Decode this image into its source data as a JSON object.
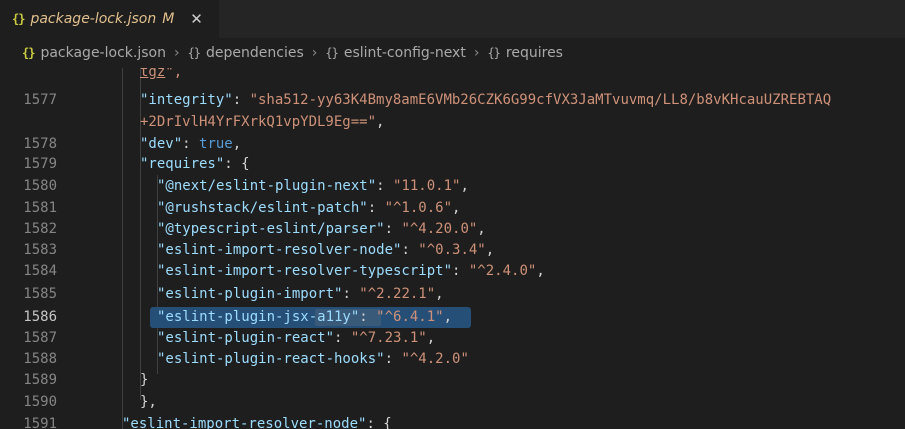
{
  "tab": {
    "icon_text": "{}",
    "title": "package-lock.json",
    "modified": "M",
    "close": "✕"
  },
  "breadcrumb": {
    "file_icon_text": "{}",
    "file": "package-lock.json",
    "obj_icon_text": "{}",
    "items": [
      "dependencies",
      "eslint-config-next",
      "requires"
    ],
    "sep": "›"
  },
  "editor": {
    "lines": [
      {
        "num": "",
        "tokens": [
          {
            "t": "tgz",
            "c": "s u"
          },
          {
            "t": "\",",
            "c": "s"
          }
        ]
      },
      {
        "num": "1577",
        "tokens": [
          {
            "t": "\"integrity\"",
            "c": "k"
          },
          {
            "t": ": ",
            "c": "p"
          },
          {
            "t": "\"sha512-yy63K4Bmy8amE6VMb26CZK6G99cfVX3JaMTvuvmq/LL8/b8vKHcauUZREBTAQ",
            "c": "s"
          }
        ]
      },
      {
        "num": "",
        "tokens": [
          {
            "t": "+2DrIvlH4YrFXrkQ1vpYDL9Eg==\"",
            "c": "s"
          },
          {
            "t": ",",
            "c": "p"
          }
        ]
      },
      {
        "num": "1578",
        "tokens": [
          {
            "t": "\"dev\"",
            "c": "k"
          },
          {
            "t": ": ",
            "c": "p"
          },
          {
            "t": "true",
            "c": "b"
          },
          {
            "t": ",",
            "c": "p"
          }
        ]
      },
      {
        "num": "1579",
        "tokens": [
          {
            "t": "\"requires\"",
            "c": "k"
          },
          {
            "t": ": {",
            "c": "p"
          }
        ]
      },
      {
        "num": "1580",
        "tokens": [
          {
            "t": "\"@next/eslint-plugin-next\"",
            "c": "k"
          },
          {
            "t": ": ",
            "c": "p"
          },
          {
            "t": "\"11.0.1\"",
            "c": "s"
          },
          {
            "t": ",",
            "c": "p"
          }
        ]
      },
      {
        "num": "1581",
        "tokens": [
          {
            "t": "\"@rushstack/eslint-patch\"",
            "c": "k"
          },
          {
            "t": ": ",
            "c": "p"
          },
          {
            "t": "\"^1.0.6\"",
            "c": "s"
          },
          {
            "t": ",",
            "c": "p"
          }
        ]
      },
      {
        "num": "1582",
        "tokens": [
          {
            "t": "\"@typescript-eslint/parser\"",
            "c": "k"
          },
          {
            "t": ": ",
            "c": "p"
          },
          {
            "t": "\"^4.20.0\"",
            "c": "s"
          },
          {
            "t": ",",
            "c": "p"
          }
        ]
      },
      {
        "num": "1583",
        "tokens": [
          {
            "t": "\"eslint-import-resolver-node\"",
            "c": "k"
          },
          {
            "t": ": ",
            "c": "p"
          },
          {
            "t": "\"^0.3.4\"",
            "c": "s"
          },
          {
            "t": ",",
            "c": "p"
          }
        ]
      },
      {
        "num": "1584",
        "tokens": [
          {
            "t": "\"eslint-import-resolver-typescript\"",
            "c": "k"
          },
          {
            "t": ": ",
            "c": "p"
          },
          {
            "t": "\"^2.4.0\"",
            "c": "s"
          },
          {
            "t": ",",
            "c": "p"
          }
        ]
      },
      {
        "num": "1585",
        "tokens": [
          {
            "t": "\"eslint-plugin-import\"",
            "c": "k"
          },
          {
            "t": ": ",
            "c": "p"
          },
          {
            "t": "\"^2.22.1\"",
            "c": "s"
          },
          {
            "t": ",",
            "c": "p"
          }
        ]
      },
      {
        "num": "1586",
        "tokens": [
          {
            "t": "\"eslint-plugin-jsx-a11y\"",
            "c": "k"
          },
          {
            "t": ": ",
            "c": "p"
          },
          {
            "t": "\"^6.4.1\"",
            "c": "s"
          },
          {
            "t": ",",
            "c": "p"
          }
        ]
      },
      {
        "num": "1587",
        "tokens": [
          {
            "t": "\"eslint-plugin-react\"",
            "c": "k"
          },
          {
            "t": ": ",
            "c": "p"
          },
          {
            "t": "\"^7.23.1\"",
            "c": "s"
          },
          {
            "t": ",",
            "c": "p"
          }
        ]
      },
      {
        "num": "1588",
        "tokens": [
          {
            "t": "\"eslint-plugin-react-hooks\"",
            "c": "k"
          },
          {
            "t": ": ",
            "c": "p"
          },
          {
            "t": "\"^4.2.0\"",
            "c": "s"
          }
        ]
      },
      {
        "num": "1589",
        "tokens": [
          {
            "t": "}",
            "c": "p"
          }
        ]
      },
      {
        "num": "1590",
        "tokens": [
          {
            "t": "},",
            "c": "p"
          }
        ]
      },
      {
        "num": "1591",
        "tokens": [
          {
            "t": "\"eslint-import-resolver-node\"",
            "c": "k"
          },
          {
            "t": ": {",
            "c": "p"
          }
        ]
      }
    ],
    "active_line": "1586"
  }
}
